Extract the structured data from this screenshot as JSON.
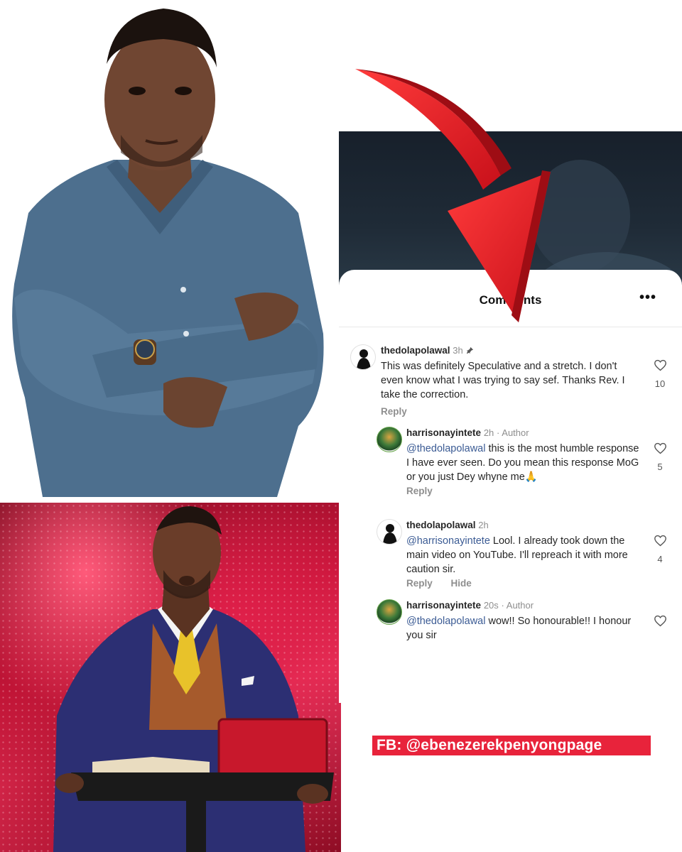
{
  "comments_sheet": {
    "title": "Comments",
    "more_label": "•••"
  },
  "comments": [
    {
      "username": "thedolapolawal",
      "time": "3h",
      "pinned_icon": "pin-icon",
      "text": "This was definitely Speculative and a stretch. I don't even know what I was trying to say sef. Thanks Rev. I take the correction.",
      "likes": "10",
      "reply_label": "Reply"
    },
    {
      "username": "harrisonayintete",
      "time": "2h",
      "badge": "· Author",
      "mention": "@thedolapolawal",
      "text": " this is the most humble response I have ever seen. Do you mean this response MoG or you just Dey whyne me🙏",
      "likes": "5",
      "reply_label": "Reply"
    },
    {
      "username": "thedolapolawal",
      "time": "2h",
      "mention": "@harrisonayintete",
      "text": " Lool. I already took down the main video on YouTube. I'll repreach it with more caution sir.",
      "likes": "4",
      "reply_label": "Reply",
      "hide_label": "Hide"
    },
    {
      "username": "harrisonayintete",
      "time": "20s",
      "badge": "· Author",
      "mention": "@thedolapolawal",
      "text": " wow!! So honourable!! I honour you sir"
    }
  ],
  "watermark": "FB: @ebenezerekpenyongpage",
  "colors": {
    "arrow": "#e01f27",
    "watermark_bg": "#e8233b",
    "mention": "#3b5b94"
  }
}
